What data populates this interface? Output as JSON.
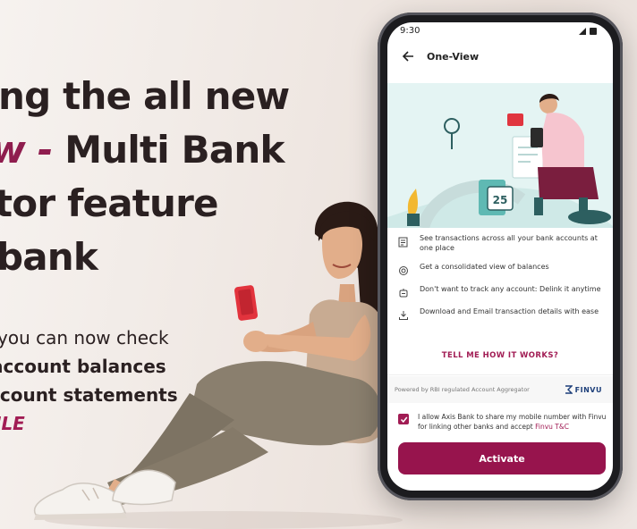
{
  "headline": {
    "line1": "ng the all new",
    "line2_accent": "w -",
    "line2_rest": " Multi Bank",
    "line3": "tor feature",
    "line4": "bank"
  },
  "subtext": {
    "line1": "you can now check",
    "line2": "account balances",
    "line3": "ccount statements",
    "line4": "ILE"
  },
  "colors": {
    "brand": "#97144d",
    "accent": "#a11c54",
    "hero_bg": "#e4f4f3"
  },
  "phone": {
    "status_time": "9:30",
    "status_icons": "signal-icon battery-icon",
    "screen_title": "One-View",
    "calendar_day": "25",
    "features": [
      {
        "icon": "list-icon",
        "text": "See transactions across all your bank accounts at one place"
      },
      {
        "icon": "coins-icon",
        "text": "Get a consolidated view of balances"
      },
      {
        "icon": "unlink-icon",
        "text": "Don't want to track any account: Delink it anytime"
      },
      {
        "icon": "download-icon",
        "text": "Download and Email transaction details with ease"
      }
    ],
    "cta_link": "TELL ME HOW IT WORKS?",
    "powered_by": "Powered by RBI regulated Account Aggregator",
    "partner_name": "FINVU",
    "consent_text": "I allow Axis Bank to share my mobile number with Finvu for linking other banks and accept ",
    "consent_link": "Finvu T&C",
    "activate_label": "Activate"
  }
}
